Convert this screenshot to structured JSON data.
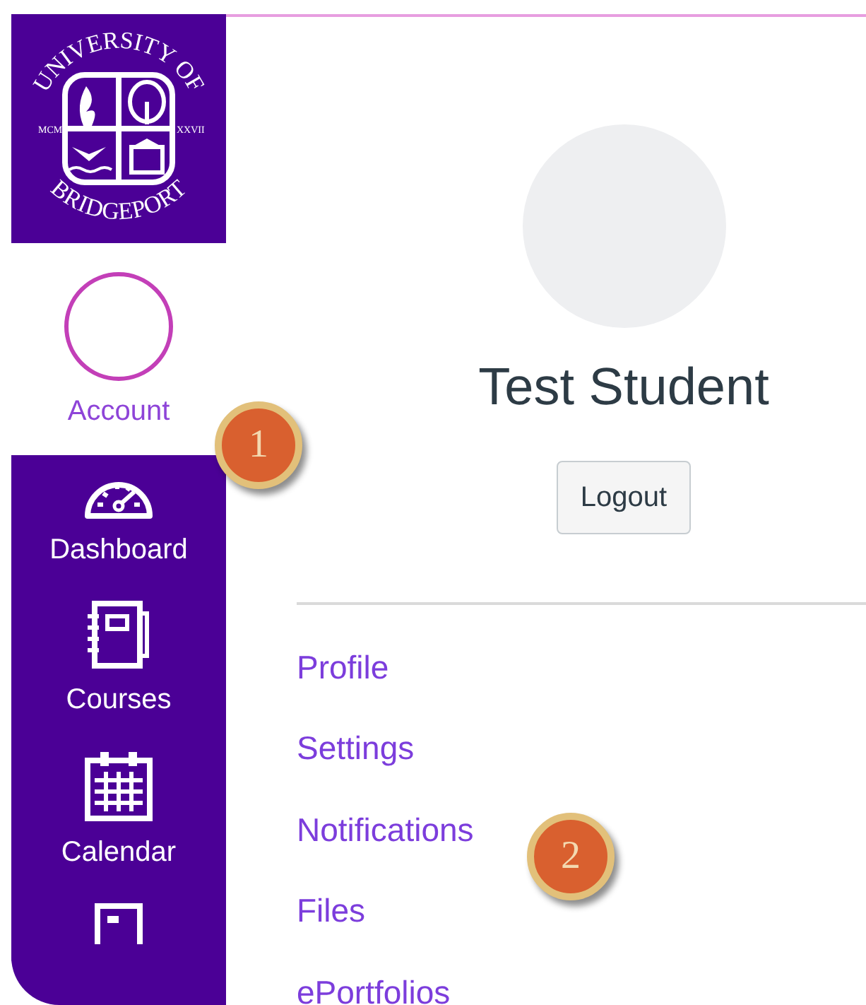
{
  "logo": {
    "top_text": "UNIVERSITY OF",
    "bottom_text": "BRIDGEPORT",
    "left_mark": "MCM",
    "right_mark": "XXVII"
  },
  "nav_items": [
    {
      "label": "Account",
      "selected": true
    },
    {
      "label": "Dashboard",
      "selected": false
    },
    {
      "label": "Courses",
      "selected": false
    },
    {
      "label": "Calendar",
      "selected": false
    }
  ],
  "profile": {
    "name": "Test Student",
    "logout_button": "Logout"
  },
  "profile_links": [
    "Profile",
    "Settings",
    "Notifications",
    "Files",
    "ePortfolios"
  ],
  "callouts": [
    "1",
    "2"
  ]
}
